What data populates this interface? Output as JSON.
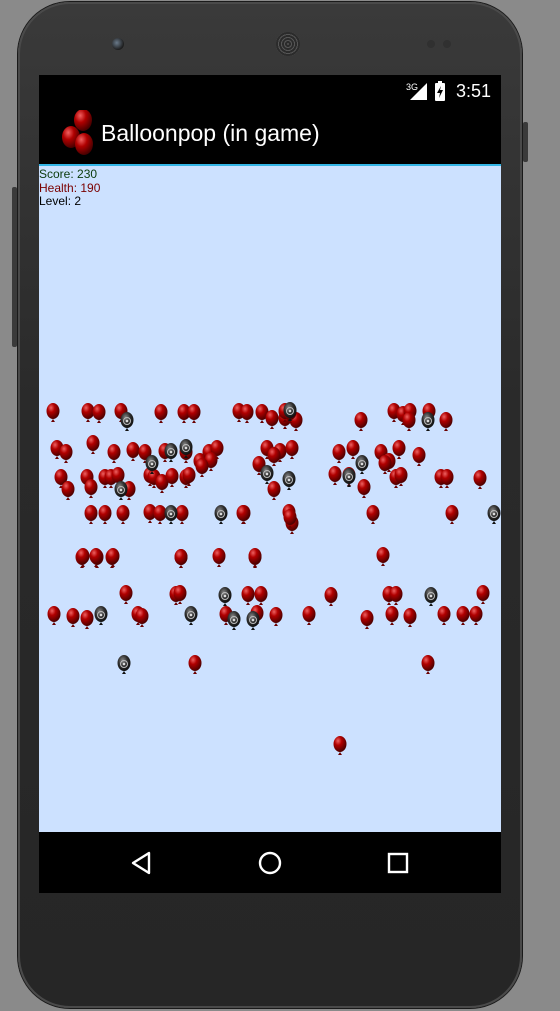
{
  "status_bar": {
    "network": "3G",
    "time": "3:51"
  },
  "app_bar": {
    "title": "Balloonpop (in game)",
    "icon": "balloon-cluster-icon"
  },
  "hud": {
    "score": "Score: 230",
    "health": "Health: 190",
    "level": "Level: 2",
    "colors": {
      "score": "#0b3b0b",
      "health": "#7a0000",
      "level": "#000000"
    }
  },
  "game": {
    "background": "#cce1ff",
    "red_balloon_count": 117,
    "bomb_balloon_count": 21
  },
  "nav_bar": {
    "back": "back-icon",
    "home": "home-icon",
    "recents": "recents-icon"
  }
}
